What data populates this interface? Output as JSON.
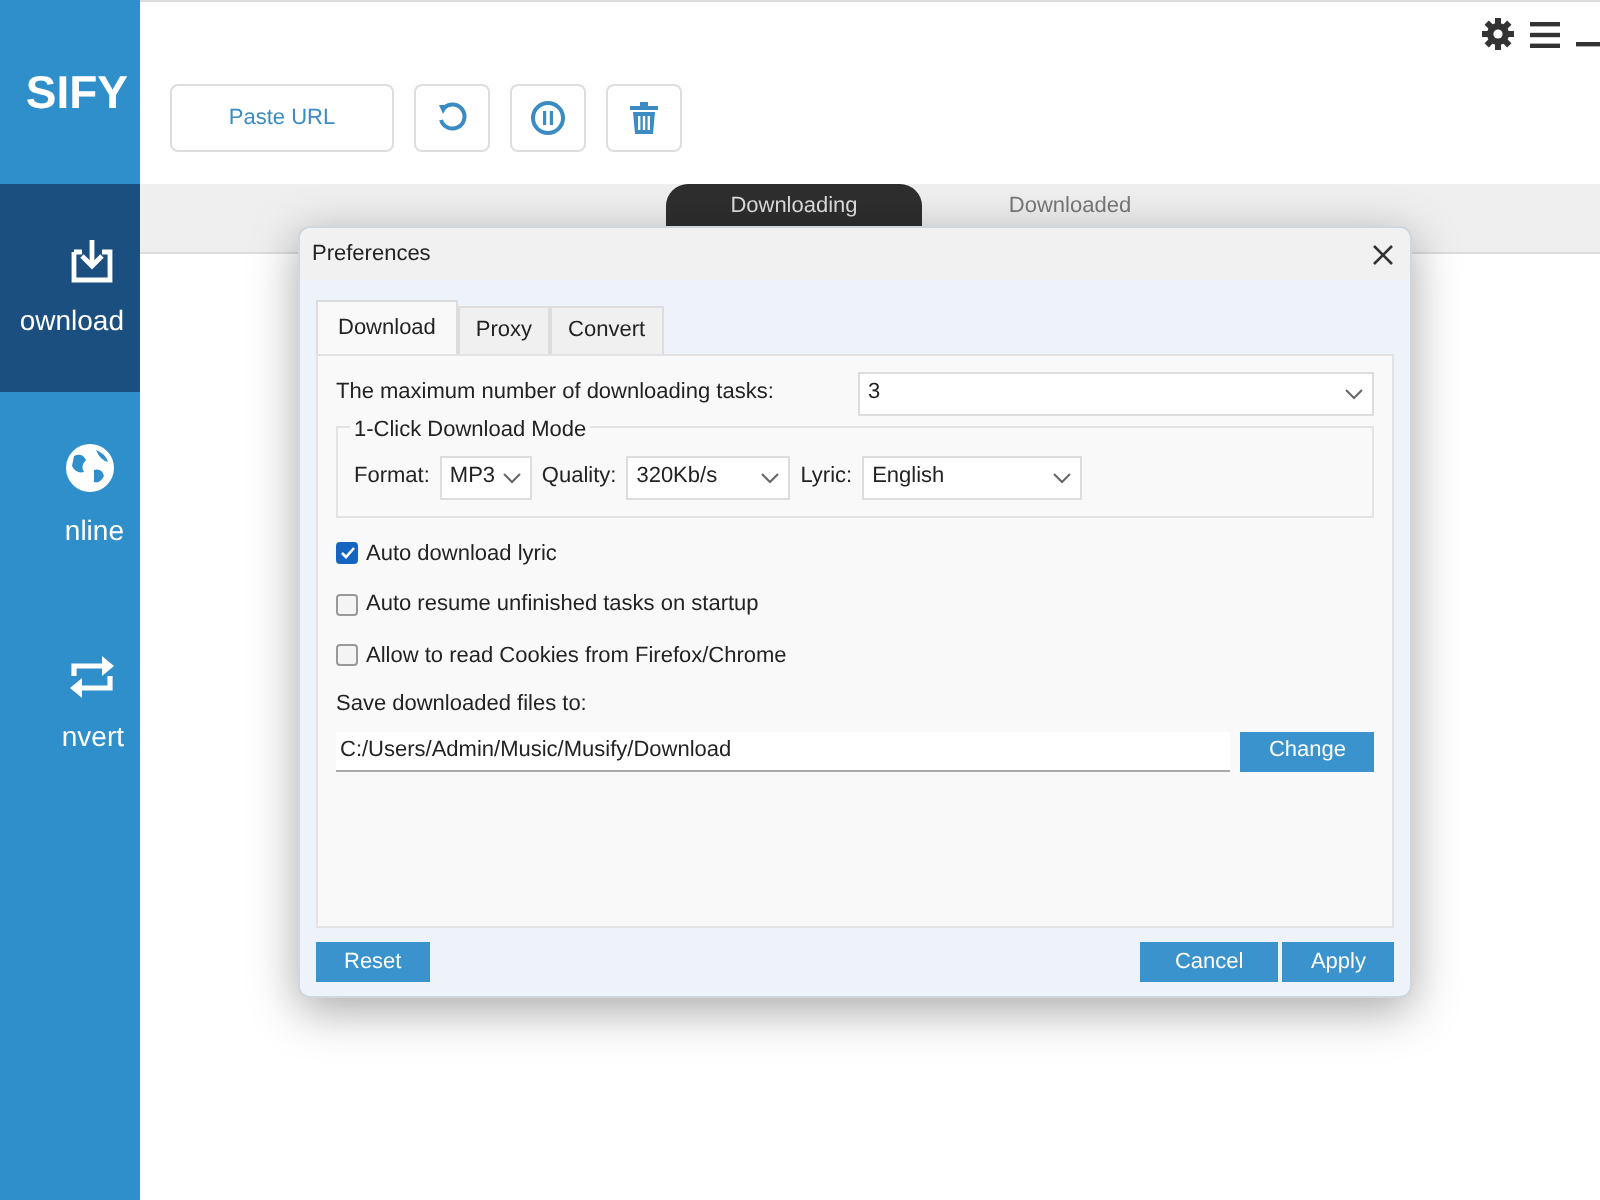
{
  "logo": "SIFY",
  "sidebar": {
    "items": [
      {
        "kind": "download",
        "label": "ownload",
        "selected": true
      },
      {
        "kind": "globe",
        "label": "nline",
        "selected": false
      },
      {
        "kind": "convert",
        "label": "nvert",
        "selected": false
      }
    ]
  },
  "toolbar": {
    "paste_button": "Paste URL"
  },
  "view_tabs": [
    {
      "label": "Downloading",
      "selected": true
    },
    {
      "label": "Downloaded",
      "selected": false
    }
  ],
  "dialog": {
    "title": "Preferences",
    "tabs": [
      {
        "label": "Download",
        "selected": true
      },
      {
        "label": "Proxy",
        "selected": false
      },
      {
        "label": "Convert",
        "selected": false
      }
    ],
    "max_tasks": {
      "label": "The maximum number of downloading tasks:",
      "value": "3"
    },
    "group": {
      "title": "1-Click Download Mode",
      "fields": [
        {
          "label": "Format:",
          "value": "MP3"
        },
        {
          "label": "Quality:",
          "value": "320Kb/s"
        },
        {
          "label": "Lyric:",
          "value": "English"
        }
      ]
    },
    "options": [
      {
        "label": "Auto download lyric",
        "checked": true
      },
      {
        "label": "Auto resume unfinished tasks on startup",
        "checked": false
      },
      {
        "label": "Allow to read Cookies from Firefox/Chrome",
        "checked": false
      }
    ],
    "save_path": {
      "label": "Save downloaded files to:",
      "value": "C:/Users/Admin/Music/Musify/Download",
      "button": "Change"
    },
    "buttons": {
      "reset": "Reset",
      "cancel": "Cancel",
      "apply": "Apply"
    }
  }
}
